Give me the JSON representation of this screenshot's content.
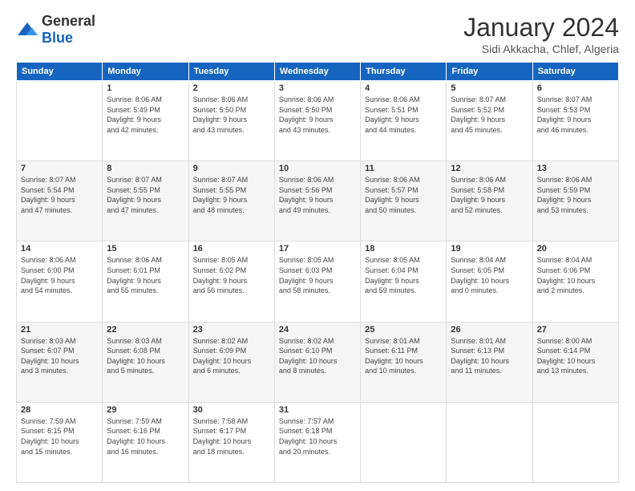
{
  "header": {
    "logo_general": "General",
    "logo_blue": "Blue",
    "month_title": "January 2024",
    "subtitle": "Sidi Akkacha, Chlef, Algeria"
  },
  "days_of_week": [
    "Sunday",
    "Monday",
    "Tuesday",
    "Wednesday",
    "Thursday",
    "Friday",
    "Saturday"
  ],
  "weeks": [
    [
      {
        "day": "",
        "info": ""
      },
      {
        "day": "1",
        "info": "Sunrise: 8:06 AM\nSunset: 5:49 PM\nDaylight: 9 hours\nand 42 minutes."
      },
      {
        "day": "2",
        "info": "Sunrise: 8:06 AM\nSunset: 5:50 PM\nDaylight: 9 hours\nand 43 minutes."
      },
      {
        "day": "3",
        "info": "Sunrise: 8:06 AM\nSunset: 5:50 PM\nDaylight: 9 hours\nand 43 minutes."
      },
      {
        "day": "4",
        "info": "Sunrise: 8:06 AM\nSunset: 5:51 PM\nDaylight: 9 hours\nand 44 minutes."
      },
      {
        "day": "5",
        "info": "Sunrise: 8:07 AM\nSunset: 5:52 PM\nDaylight: 9 hours\nand 45 minutes."
      },
      {
        "day": "6",
        "info": "Sunrise: 8:07 AM\nSunset: 5:53 PM\nDaylight: 9 hours\nand 46 minutes."
      }
    ],
    [
      {
        "day": "7",
        "info": "Sunrise: 8:07 AM\nSunset: 5:54 PM\nDaylight: 9 hours\nand 47 minutes."
      },
      {
        "day": "8",
        "info": "Sunrise: 8:07 AM\nSunset: 5:55 PM\nDaylight: 9 hours\nand 47 minutes."
      },
      {
        "day": "9",
        "info": "Sunrise: 8:07 AM\nSunset: 5:55 PM\nDaylight: 9 hours\nand 48 minutes."
      },
      {
        "day": "10",
        "info": "Sunrise: 8:06 AM\nSunset: 5:56 PM\nDaylight: 9 hours\nand 49 minutes."
      },
      {
        "day": "11",
        "info": "Sunrise: 8:06 AM\nSunset: 5:57 PM\nDaylight: 9 hours\nand 50 minutes."
      },
      {
        "day": "12",
        "info": "Sunrise: 8:06 AM\nSunset: 5:58 PM\nDaylight: 9 hours\nand 52 minutes."
      },
      {
        "day": "13",
        "info": "Sunrise: 8:06 AM\nSunset: 5:59 PM\nDaylight: 9 hours\nand 53 minutes."
      }
    ],
    [
      {
        "day": "14",
        "info": "Sunrise: 8:06 AM\nSunset: 6:00 PM\nDaylight: 9 hours\nand 54 minutes."
      },
      {
        "day": "15",
        "info": "Sunrise: 8:06 AM\nSunset: 6:01 PM\nDaylight: 9 hours\nand 55 minutes."
      },
      {
        "day": "16",
        "info": "Sunrise: 8:05 AM\nSunset: 6:02 PM\nDaylight: 9 hours\nand 56 minutes."
      },
      {
        "day": "17",
        "info": "Sunrise: 8:05 AM\nSunset: 6:03 PM\nDaylight: 9 hours\nand 58 minutes."
      },
      {
        "day": "18",
        "info": "Sunrise: 8:05 AM\nSunset: 6:04 PM\nDaylight: 9 hours\nand 59 minutes."
      },
      {
        "day": "19",
        "info": "Sunrise: 8:04 AM\nSunset: 6:05 PM\nDaylight: 10 hours\nand 0 minutes."
      },
      {
        "day": "20",
        "info": "Sunrise: 8:04 AM\nSunset: 6:06 PM\nDaylight: 10 hours\nand 2 minutes."
      }
    ],
    [
      {
        "day": "21",
        "info": "Sunrise: 8:03 AM\nSunset: 6:07 PM\nDaylight: 10 hours\nand 3 minutes."
      },
      {
        "day": "22",
        "info": "Sunrise: 8:03 AM\nSunset: 6:08 PM\nDaylight: 10 hours\nand 5 minutes."
      },
      {
        "day": "23",
        "info": "Sunrise: 8:02 AM\nSunset: 6:09 PM\nDaylight: 10 hours\nand 6 minutes."
      },
      {
        "day": "24",
        "info": "Sunrise: 8:02 AM\nSunset: 6:10 PM\nDaylight: 10 hours\nand 8 minutes."
      },
      {
        "day": "25",
        "info": "Sunrise: 8:01 AM\nSunset: 6:11 PM\nDaylight: 10 hours\nand 10 minutes."
      },
      {
        "day": "26",
        "info": "Sunrise: 8:01 AM\nSunset: 6:13 PM\nDaylight: 10 hours\nand 11 minutes."
      },
      {
        "day": "27",
        "info": "Sunrise: 8:00 AM\nSunset: 6:14 PM\nDaylight: 10 hours\nand 13 minutes."
      }
    ],
    [
      {
        "day": "28",
        "info": "Sunrise: 7:59 AM\nSunset: 6:15 PM\nDaylight: 10 hours\nand 15 minutes."
      },
      {
        "day": "29",
        "info": "Sunrise: 7:59 AM\nSunset: 6:16 PM\nDaylight: 10 hours\nand 16 minutes."
      },
      {
        "day": "30",
        "info": "Sunrise: 7:58 AM\nSunset: 6:17 PM\nDaylight: 10 hours\nand 18 minutes."
      },
      {
        "day": "31",
        "info": "Sunrise: 7:57 AM\nSunset: 6:18 PM\nDaylight: 10 hours\nand 20 minutes."
      },
      {
        "day": "",
        "info": ""
      },
      {
        "day": "",
        "info": ""
      },
      {
        "day": "",
        "info": ""
      }
    ]
  ]
}
